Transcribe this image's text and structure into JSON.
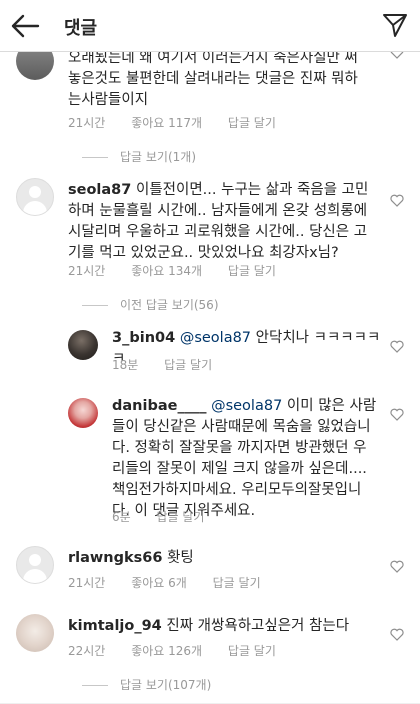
{
  "header": {
    "title": "댓글",
    "back_icon": "back-arrow-icon",
    "send_icon": "direct-send-icon"
  },
  "comments": [
    {
      "text": "오래됬는데 왜 여기서 이러는거지  죽은사실만 써놓은것도 불편한데 살려내라는 댓글은 진짜 뭐하는사람들이지",
      "time": "21시간",
      "likes": "좋아요 117개",
      "reply": "답글 달기",
      "view_replies": "답글 보기(1개)"
    },
    {
      "username": "seola87",
      "text": " 이틀전이면... 누구는 삶과 죽음을 고민하며 눈물흘릴 시간에.. 남자들에게 온갖 성희롱에 시달리며 우울하고 괴로워했을 시간에.. 당신은 고기를 먹고 있었군요.. 맛있었나요 최강자x님?",
      "time": "21시간",
      "likes": "좋아요 134개",
      "reply": "답글 달기",
      "view_replies": "이전 답글 보기(56)"
    },
    {
      "username": "3_bin04",
      "mention": "@seola87",
      "text": " 안닥치나 ㅋㅋㅋㅋㅋㅋ",
      "time": "18분",
      "reply": "답글 달기"
    },
    {
      "username": "danibae____",
      "mention": "@seola87",
      "text": " 이미 많은 사람들이 당신같은 사람때문에 목숨을 잃었습니다. 정확히 잘잘못을 까지자면 방관했던 우리들의 잘못이 제일 크지 않을까 싶은데.... 책임전가하지마세요. 우리모두의잘못입니다. 이 댓글 지워주세요.",
      "time": "6분",
      "reply": "답글 달기"
    },
    {
      "username": "rlawngks66",
      "text": " 홧팅",
      "time": "21시간",
      "likes": "좋아요 6개",
      "reply": "답글 달기"
    },
    {
      "username": "kimtaljo_94",
      "text": " 진짜 개쌍욕하고싶은거 참는다",
      "time": "22시간",
      "likes": "좋아요 126개",
      "reply": "답글 달기",
      "view_replies": "답글 보기(107개)"
    }
  ]
}
